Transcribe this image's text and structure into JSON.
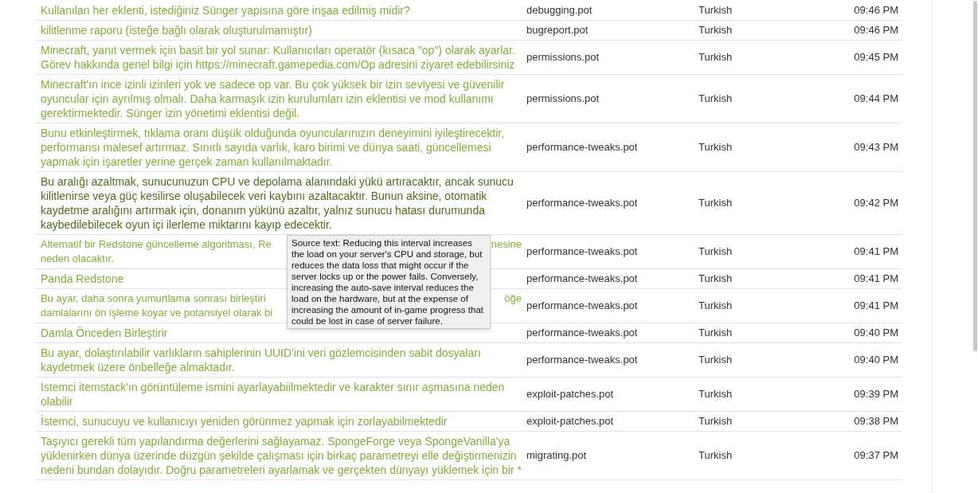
{
  "rows": [
    {
      "kind": "full",
      "text": "Kullanılan her eklenti, istediğiniz Sünger yapısına göre inşaa edilmiş midir?",
      "file": "debugging.pot",
      "language": "Turkish",
      "time": "09:46 PM",
      "hovered": false
    },
    {
      "kind": "full",
      "text": "kilitlenme raporu (isteğe bağlı olarak oluşturulmamıştır)",
      "file": "bugreport.pot",
      "language": "Turkish",
      "time": "09:46 PM",
      "hovered": false
    },
    {
      "kind": "full",
      "text": "Minecraft, yanıt vermek için basit bir yol sunar: Kullanıcıları operatör (kısaca \"op\") olarak ayarlar. Görev hakkında genel bilgi için https://minecraft.gamepedia.com/Op adresini ziyaret edebilirsiniz",
      "file": "permissions.pot",
      "language": "Turkish",
      "time": "09:45 PM",
      "hovered": false
    },
    {
      "kind": "full",
      "text": "Minecraft'ın ince izinli izinleri yok ve sadece op var. Bu çok yüksek bir izin seviyesi ve güvenilir oyuncular için ayrılmış olmalı. Daha karmaşık izin kurulumları izin eklentisi ve mod kullanımı gerektirmektedir. Sünger izin yönetimi eklentisi değil.",
      "file": "permissions.pot",
      "language": "Turkish",
      "time": "09:44 PM",
      "hovered": false
    },
    {
      "kind": "full",
      "text": "Bunu etkinleştirmek, tıklama oranı düşük olduğunda oyuncularınızın deneyimini iyileştirecektir, performansı malesef artırmaz. Sınırlı sayıda varlık, karo birimi ve dünya saati, güncellemesi yapmak için işaretler yerine gerçek zaman kullanılmaktadır.",
      "file": "performance-tweaks.pot",
      "language": "Turkish",
      "time": "09:43 PM",
      "hovered": false
    },
    {
      "kind": "full",
      "text": "Bu aralığı azaltmak, sunucunuzun CPU ve depolama alanındaki yükü artıracaktır, ancak sunucu kilitlenirse veya güç kesilirse oluşabilecek veri kaybını azaltacaktır. Bunun aksine, otomatik kaydetme aralığını artırmak için, donanım yükünü azaltır, yalnız sunucu hatası durumunda kaybedilebilecek oyun içi ilerleme miktarını kayıp edecektir.",
      "file": "performance-tweaks.pot",
      "language": "Turkish",
      "time": "09:42 PM",
      "hovered": true
    },
    {
      "kind": "covered",
      "lines": [
        {
          "start": "Alternatif bir Redstone güncelleme algoritması, Re",
          "end": "nesine"
        },
        {
          "start": "neden olacaktır."
        }
      ],
      "file": "performance-tweaks.pot",
      "language": "Turkish",
      "time": "09:41 PM",
      "hovered": false
    },
    {
      "kind": "full",
      "text": "Panda Redstone",
      "file": "performance-tweaks.pot",
      "language": "Turkish",
      "time": "09:41 PM",
      "hovered": false
    },
    {
      "kind": "covered",
      "lines": [
        {
          "start": "Bu ayar, daha sonra yumurtlama sonrası birleştiri",
          "end": "öğe"
        },
        {
          "start": "damlalarını ön işleme koyar ve potansiyel olarak bi"
        }
      ],
      "file": "performance-tweaks.pot",
      "language": "Turkish",
      "time": "09:41 PM",
      "hovered": false
    },
    {
      "kind": "full",
      "text": "Damla Önceden Birleştirir",
      "file": "performance-tweaks.pot",
      "language": "Turkish",
      "time": "09:40 PM",
      "hovered": false
    },
    {
      "kind": "full",
      "text": "Bu ayar, dolaştırılabilir varlıkların sahiplerinin UUID'ini veri gözlemcisinden sabit dosyaları kaydetmek üzere önbelleğe almaktadır.",
      "file": "performance-tweaks.pot",
      "language": "Turkish",
      "time": "09:40 PM",
      "hovered": false
    },
    {
      "kind": "full",
      "text": "Istemci itemstack'ın görüntüleme ismini ayarlayabiilmektedir ve karakter sınır aşmasına neden olabilir",
      "file": "exploit-patches.pot",
      "language": "Turkish",
      "time": "09:39 PM",
      "hovered": false
    },
    {
      "kind": "full",
      "text": "İstemci, sunucuyu ve kullanıcıyı yeniden görünmez yapmak için zorlayabilmektedir",
      "file": "exploit-patches.pot",
      "language": "Turkish",
      "time": "09:38 PM",
      "hovered": false
    },
    {
      "kind": "full",
      "text": "Taşıyıcı gerekli tüm yapılandırma değerlerini sağlayamaz. SpongeForge veya SpongeVanilla'ya yüklenirken dünya üzerinde düzgün şekilde çalışması için birkaç parametreyi elle değiştirmenizin nedeni bundan dolayıdır. Doğru parametreleri ayarlamak ve gerçekten dünyayı yüklemek için bir *",
      "file": "migrating.pot",
      "language": "Turkish",
      "time": "09:37 PM",
      "hovered": false
    }
  ],
  "tooltip": {
    "text": "Source text: Reducing this interval increases the load on your server's CPU and storage, but reduces the data loss that might occur if the server locks up or the power fails. Conversely, increasing the auto-save interval reduces the load on the hardware, but at the expense of increasing the amount of in-game progress that could be lost in case of server failure."
  }
}
